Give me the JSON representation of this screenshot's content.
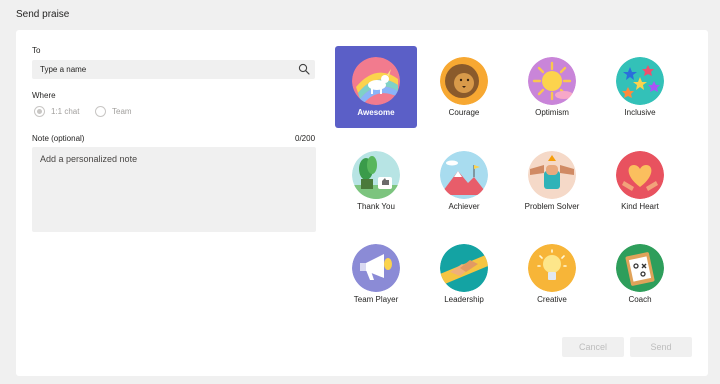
{
  "header": {
    "title": "Send praise"
  },
  "form": {
    "to_label": "To",
    "to_placeholder": "Type a name",
    "where_label": "Where",
    "where_options": [
      "1:1 chat",
      "Team"
    ],
    "where_selected": "1:1 chat",
    "note_label": "Note (optional)",
    "note_counter": "0/200",
    "note_placeholder": "Add a personalized note"
  },
  "badges": [
    {
      "label": "Awesome",
      "icon": "unicorn-rainbow-icon",
      "selected": true
    },
    {
      "label": "Courage",
      "icon": "lion-icon"
    },
    {
      "label": "Optimism",
      "icon": "sun-icon"
    },
    {
      "label": "Inclusive",
      "icon": "stars-icon"
    },
    {
      "label": "Thank You",
      "icon": "plant-thumbs-up-icon"
    },
    {
      "label": "Achiever",
      "icon": "mountain-flag-icon"
    },
    {
      "label": "Problem Solver",
      "icon": "fist-icon"
    },
    {
      "label": "Kind Heart",
      "icon": "heart-hands-icon"
    },
    {
      "label": "Team Player",
      "icon": "megaphone-icon"
    },
    {
      "label": "Leadership",
      "icon": "handshake-icon"
    },
    {
      "label": "Creative",
      "icon": "lightbulb-icon"
    },
    {
      "label": "Coach",
      "icon": "clipboard-icon"
    }
  ],
  "actions": {
    "cancel": "Cancel",
    "send": "Send"
  },
  "colors": {
    "accent": "#5b5fc7",
    "disabled_text": "#bdbdbd",
    "field_bg": "#f0f0f0"
  }
}
